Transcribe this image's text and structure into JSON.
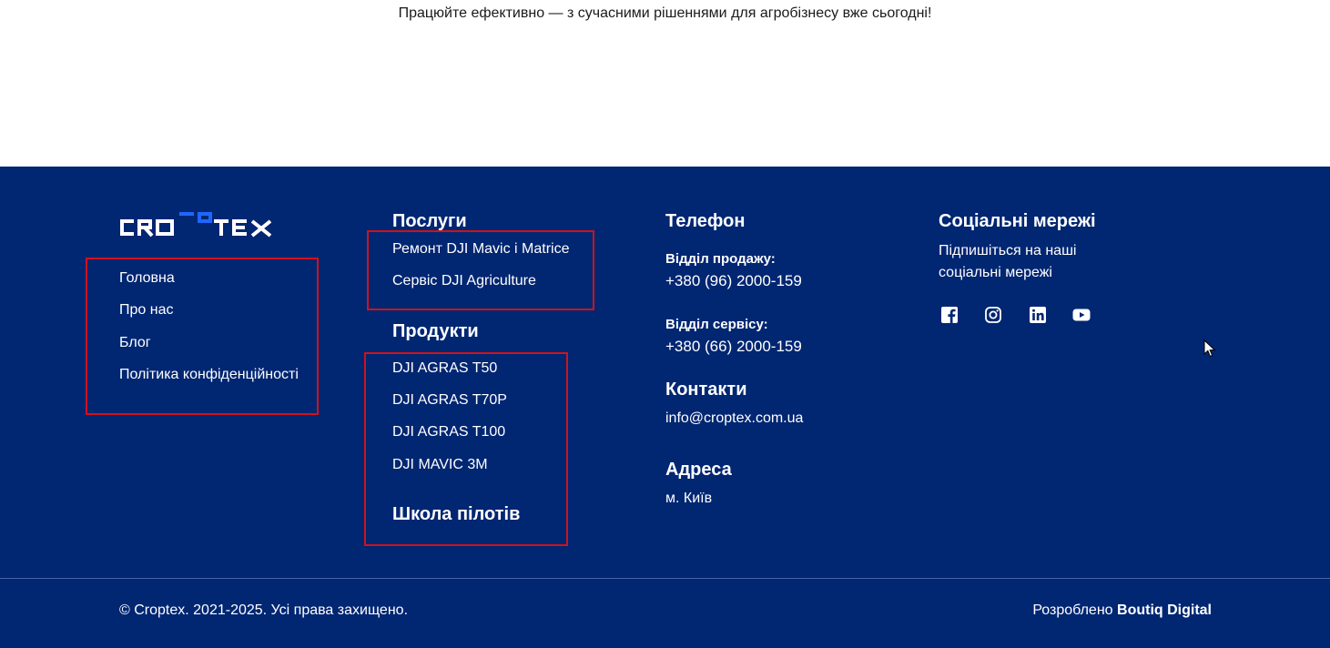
{
  "tagline": "Працюйте ефективно — з сучасними рішеннями для агробізнесу вже сьогодні!",
  "logo": {
    "text": "CROPTEX",
    "accent_color": "#1f66ff"
  },
  "nav": [
    {
      "label": "Головна"
    },
    {
      "label": "Про нас"
    },
    {
      "label": "Блог"
    },
    {
      "label": "Політика конфіденційності"
    }
  ],
  "services": {
    "title": "Послуги",
    "items": [
      {
        "label": "Ремонт DJI Mavic і Matrice"
      },
      {
        "label": "Сервіс DJI Agriculture"
      }
    ]
  },
  "products": {
    "title": "Продукти",
    "items": [
      {
        "label": "DJI AGRAS T50"
      },
      {
        "label": "DJI AGRAS T70P"
      },
      {
        "label": "DJI AGRAS T100"
      },
      {
        "label": "DJI MAVIC 3M"
      }
    ],
    "school": "Школа пілотів"
  },
  "contacts": {
    "phone_title": "Телефон",
    "sales_label": "Відділ продажу:",
    "sales_phone": "+380 (96) 2000-159",
    "service_label": "Відділ сервісу:",
    "service_phone": "+380 (66) 2000-159",
    "contacts_title": "Контакти",
    "email": "info@croptex.com.ua",
    "address_title": "Адреса",
    "address": "м. Київ"
  },
  "social": {
    "title": "Соціальні мережі",
    "text": "Підпишіться на наші соціальні мережі",
    "icons": [
      "facebook-icon",
      "instagram-icon",
      "linkedin-icon",
      "youtube-icon"
    ]
  },
  "bottom": {
    "copyright": "© Croptex. 2021-2025. Усі права захищено.",
    "dev_prefix": "Розроблено",
    "dev_name": "Boutiq Digital"
  },
  "colors": {
    "footer_bg": "#012672",
    "highlight": "#d0121b"
  }
}
